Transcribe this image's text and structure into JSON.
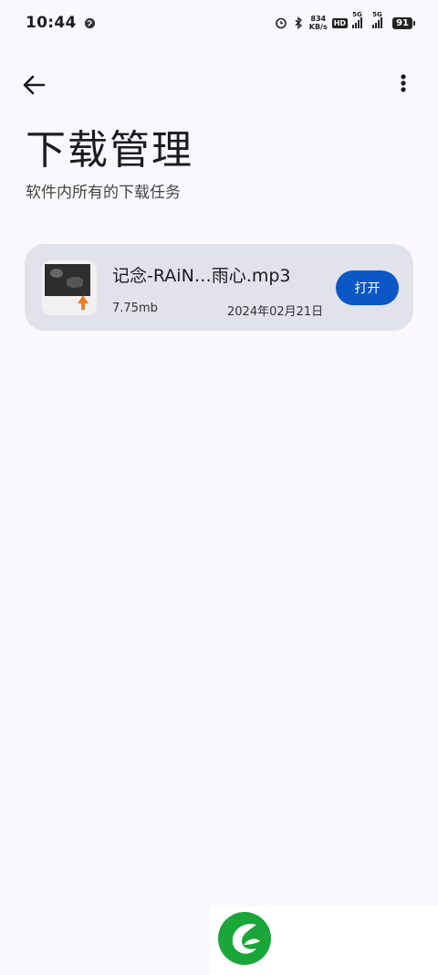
{
  "status_bar": {
    "time": "10:44",
    "net_speed_value": "834",
    "net_speed_unit": "KB/s",
    "hd_label": "HD",
    "sim1_label": "5G",
    "sim2_label": "5G",
    "battery": "91"
  },
  "header": {
    "title": "下载管理",
    "subtitle": "软件内所有的下载任务",
    "back_icon": "arrow-left-icon",
    "more_icon": "more-vert-icon"
  },
  "downloads": [
    {
      "name": "记念-RAiN…雨心.mp3",
      "size": "7.75mb",
      "date": "2024年02月21日",
      "action_label": "打开"
    }
  ],
  "colors": {
    "background": "#fbf8fd",
    "card": "#e1e2ec",
    "accent": "#0b57c6",
    "logo_green": "#1aa639"
  }
}
